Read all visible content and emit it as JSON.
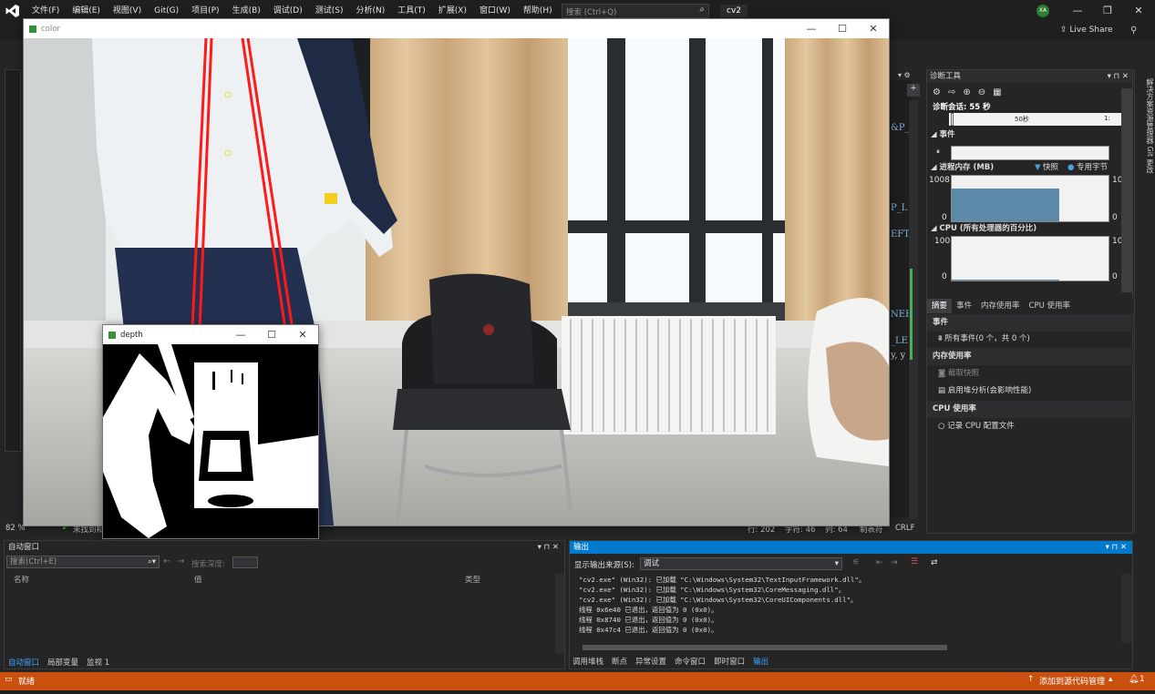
{
  "menubar": {
    "items": [
      "文件(F)",
      "编辑(E)",
      "视图(V)",
      "Git(G)",
      "项目(P)",
      "生成(B)",
      "调试(D)",
      "测试(S)",
      "分析(N)",
      "工具(T)",
      "扩展(X)",
      "窗口(W)",
      "帮助(H)"
    ],
    "search_placeholder": "搜索 (Ctrl+Q)",
    "solution_name": "cv2",
    "avatar_initials": "XA",
    "live_share": "Live Share"
  },
  "editor": {
    "code_fragments": [
      "&P_(",
      "P_L",
      "EFT",
      "NEE",
      "_LE",
      "y, y"
    ],
    "zoom": "82 %",
    "issues": "未找到相",
    "line": "行: 202",
    "char": "字符: 46",
    "col": "列: 64",
    "tabs": "制表符",
    "eol": "CRLF"
  },
  "color_window": {
    "title": "color",
    "min": "—",
    "max": "☐",
    "close": "✕"
  },
  "depth_window": {
    "title": "depth",
    "min": "—",
    "max": "☐",
    "close": "✕"
  },
  "diagnostics": {
    "title": "诊断工具",
    "session": "诊断会话: 55 秒",
    "timeline_label": "50秒",
    "timeline_label_end": "1:",
    "events_header": "事件",
    "memory_header": "进程内存 (MB)",
    "snapshot_legend": "快照",
    "private_bytes_legend": "专用字节",
    "mem_max": "1008",
    "mem_min": "0",
    "mem_right_max": "10",
    "mem_right_min": "0",
    "cpu_header": "CPU (所有处理器的百分比)",
    "cpu_max": "100",
    "cpu_min": "0",
    "cpu_right_max": "10",
    "cpu_right_min": "0",
    "tabs": [
      "摘要",
      "事件",
      "内存使用率",
      "CPU 使用率"
    ],
    "section_events": "事件",
    "all_events": "所有事件(0 个，共 0 个)",
    "section_memory": "内存使用率",
    "take_snapshot": "截取快照",
    "heap_analysis": "启用堆分析(会影响性能)",
    "section_cpu": "CPU 使用率",
    "record_cpu": "记录 CPU 配置文件",
    "memory_fill": 0.72,
    "accent_bar_color": "#5d8aa8"
  },
  "right_rail": {
    "label": "解决方案资源管理器  Git 更改"
  },
  "autos": {
    "title": "自动窗口",
    "search_placeholder": "搜索(Ctrl+E)",
    "search_depth_label": "搜索深度:",
    "col_name": "名称",
    "col_value": "值",
    "col_type": "类型",
    "tabs": [
      "自动窗口",
      "局部变量",
      "监视 1"
    ]
  },
  "output": {
    "title": "输出",
    "source_label": "显示输出来源(S):",
    "source_value": "调试",
    "lines": [
      "\"cv2.exe\" (Win32): 已加载 \"C:\\Windows\\System32\\TextInputFramework.dll\"。",
      "\"cv2.exe\" (Win32): 已加载 \"C:\\Windows\\System32\\CoreMessaging.dll\"。",
      "\"cv2.exe\" (Win32): 已加载 \"C:\\Windows\\System32\\CoreUIComponents.dll\"。",
      "线程 0x6e40 已退出，返回值为 0 (0x0)。",
      "线程 0x8740 已退出，返回值为 0 (0x0)。",
      "线程 0x47c4 已退出，返回值为 0 (0x0)。"
    ],
    "tabs": [
      "调用堆栈",
      "断点",
      "异常设置",
      "命令窗口",
      "即时窗口",
      "输出"
    ]
  },
  "statusbar": {
    "ready": "就绪",
    "source_control": "添加到源代码管理",
    "notifications": "1"
  },
  "colors": {
    "accent": "#007acc",
    "statusbar": "#ca5010"
  }
}
